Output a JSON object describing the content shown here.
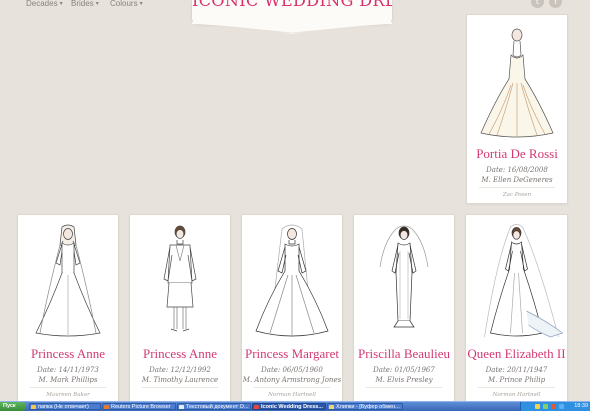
{
  "header": {
    "nav": [
      "Decades",
      "Brides",
      "Colours"
    ],
    "title": "ICONIC WEDDING DRESSES"
  },
  "social_icons": [
    "twitter-icon",
    "facebook-icon"
  ],
  "cards": [
    {
      "name": "Portia De Rossi",
      "date": "Date: 16/08/2008",
      "spouse": "M. Ellen DeGeneres",
      "designer": "Zac Posen"
    },
    {
      "name": "Princess Anne",
      "date": "Date: 14/11/1973",
      "spouse": "M. Mark Phillips",
      "designer": "Maureen Baker"
    },
    {
      "name": "Princess Anne",
      "date": "Date: 12/12/1992",
      "spouse": "M. Timothy Laurence",
      "designer": ""
    },
    {
      "name": "Princess Margaret",
      "date": "Date: 06/05/1960",
      "spouse": "M. Antony Armstrong Jones",
      "designer": "Norman Hartnell"
    },
    {
      "name": "Priscilla Beaulieu",
      "date": "Date: 01/05/1967",
      "spouse": "M. Elvis Presley",
      "designer": ""
    },
    {
      "name": "Queen Elizabeth II",
      "date": "Date: 20/11/1947",
      "spouse": "M. Prince Philip",
      "designer": "Norman Hartnell"
    }
  ],
  "taskbar": {
    "start_label": "Пуск",
    "tasks": [
      "папка (Не отвечает)",
      "Reuters Picture Browser",
      "Текстовый документ О...",
      "Iconic Wedding Dress...",
      "Хлипки - [Буфер обмен..."
    ],
    "language": "EN",
    "clock": "18:39"
  },
  "colors": {
    "accent": "#d23a74",
    "background": "#e7e2dc",
    "taskbar": "#3a66b5"
  }
}
